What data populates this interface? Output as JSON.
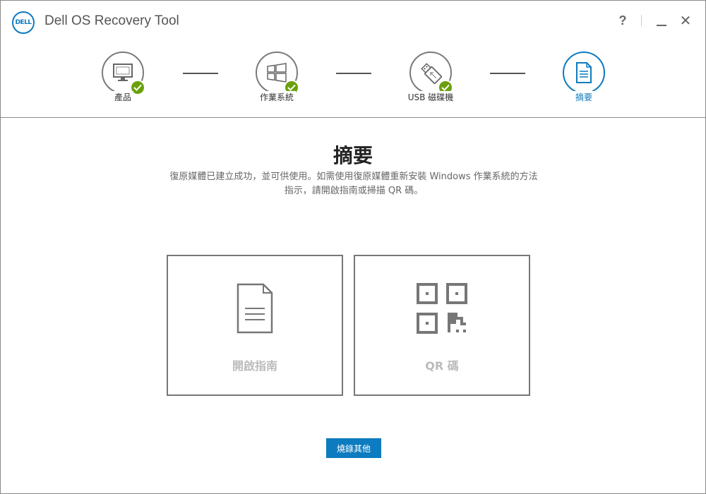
{
  "app": {
    "title": "Dell OS Recovery Tool",
    "logo_text": "DELL",
    "help_label": "?",
    "close_label": "✕"
  },
  "stepper": {
    "steps": [
      {
        "label": "產品",
        "icon": "monitor-icon",
        "completed": true
      },
      {
        "label": "作業系統",
        "icon": "windows-icon",
        "completed": true
      },
      {
        "label": "USB 磁碟機",
        "icon": "usb-drive-icon",
        "completed": true
      },
      {
        "label": "摘要",
        "icon": "document-icon",
        "completed": false,
        "active": true
      }
    ]
  },
  "main": {
    "title": "摘要",
    "description_line1": "復原媒體已建立成功，並可供使用。如需使用復原媒體重新安裝 Windows 作業系統的方法",
    "description_line2": "指示，請開啟指南或掃描 QR 碼。",
    "cards": [
      {
        "label": "開啟指南",
        "icon": "document-icon"
      },
      {
        "label": "QR 碼",
        "icon": "qr-code-icon"
      }
    ],
    "burn_button_label": "燒錄其他"
  },
  "colors": {
    "accent": "#0c7bbf",
    "check": "#6aa10a",
    "border": "#777777",
    "disabled_text": "#bbbbbb"
  }
}
